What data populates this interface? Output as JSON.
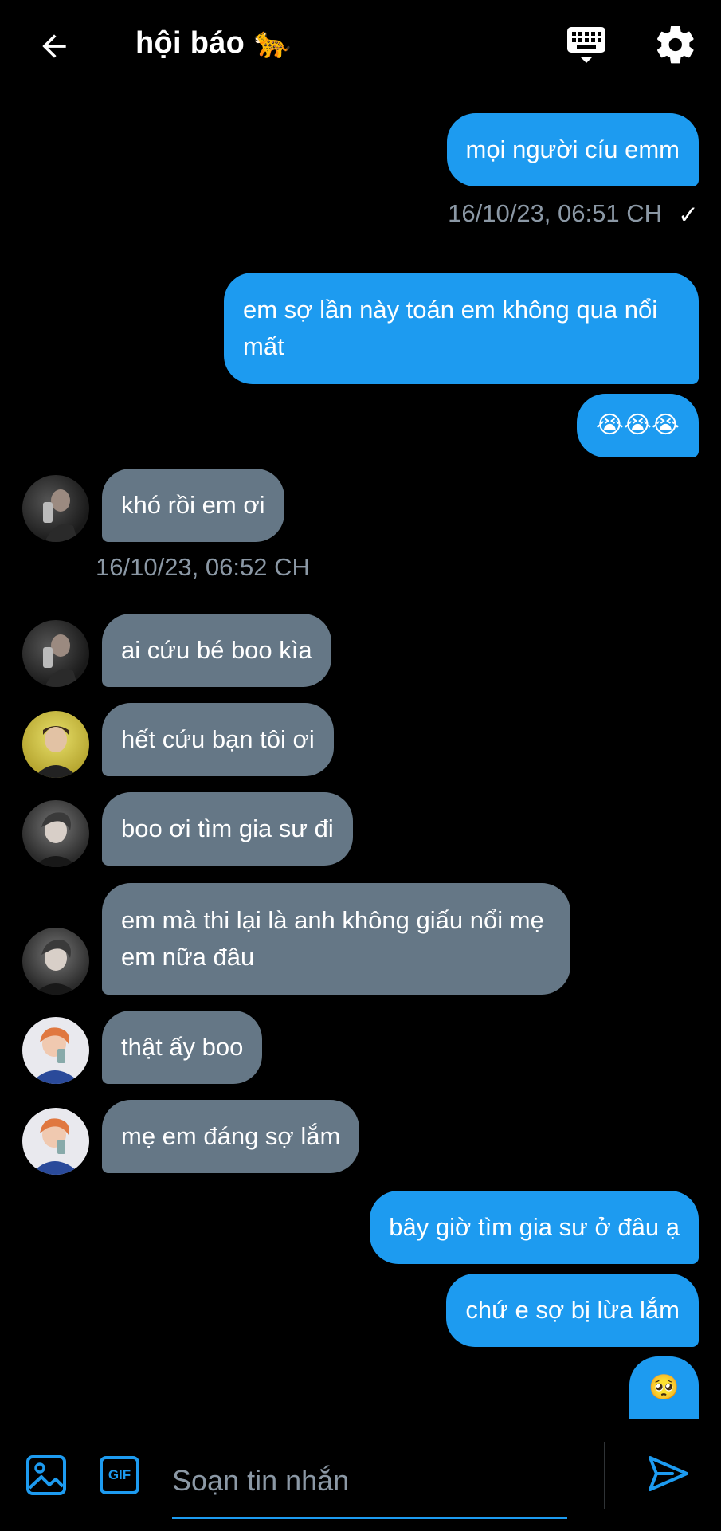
{
  "header": {
    "title": "hội báo 🐆",
    "icons": [
      "back-arrow-icon",
      "keyboard-icon",
      "gear-icon"
    ]
  },
  "messages": [
    {
      "dir": "out",
      "text": "mọi người cíu emm"
    },
    {
      "dir": "out",
      "text": "em sợ lần này toán em không qua nổi mất"
    },
    {
      "dir": "out",
      "text": "😭😭😭"
    },
    {
      "dir": "in",
      "text": "khó rồi em ơi"
    },
    {
      "dir": "in",
      "text": "ai cứu bé boo kìa"
    },
    {
      "dir": "in",
      "text": "hết cứu bạn tôi ơi"
    },
    {
      "dir": "in",
      "text": "boo ơi tìm gia sư đi"
    },
    {
      "dir": "in",
      "text": "em mà thi lại là anh không giấu nổi mẹ em nữa đâu"
    },
    {
      "dir": "in",
      "text": "thật ấy boo"
    },
    {
      "dir": "in",
      "text": "mẹ em đáng sợ lắm"
    },
    {
      "dir": "out",
      "text": "bây giờ tìm gia sư ở đâu ạ"
    },
    {
      "dir": "out",
      "text": "chứ e sợ bị lừa lắm"
    },
    {
      "dir": "out",
      "text": "🥺"
    }
  ],
  "timestamps": {
    "first": "16/10/23, 06:51 CH",
    "second": "16/10/23, 06:52 CH",
    "check": "✓"
  },
  "composer": {
    "placeholder": "Soạn tin nhắn",
    "gif_label": "GIF"
  },
  "colors": {
    "accent": "#1d9bf0",
    "incoming_bubble": "#657786",
    "background": "#000000",
    "timestamp": "#8b98a5"
  }
}
